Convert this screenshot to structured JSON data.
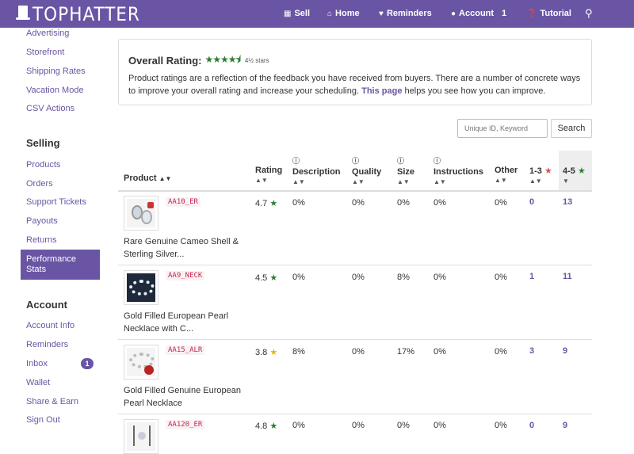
{
  "brand": "TOPHATTER",
  "nav": {
    "sell": "Sell",
    "home": "Home",
    "reminders": "Reminders",
    "account": "Account",
    "account_count": "1",
    "tutorial": "Tutorial"
  },
  "sidebar": {
    "top_items": [
      "Advertising",
      "Storefront",
      "Shipping Rates",
      "Vacation Mode",
      "CSV Actions"
    ],
    "selling_head": "Selling",
    "selling_items": [
      "Products",
      "Orders",
      "Support Tickets",
      "Payouts",
      "Returns"
    ],
    "active_item": "Performance Stats",
    "account_head": "Account",
    "account_items": [
      "Account Info",
      "Reminders",
      "Inbox",
      "Wallet",
      "Share & Earn",
      "Sign Out"
    ],
    "inbox_badge": "1"
  },
  "rating_panel": {
    "title": "Overall Rating:",
    "stars_label": "4½ stars",
    "text_before": "Product ratings are a reflection of the feedback you have received from buyers. There are a number of concrete ways to improve your overall rating and increase your scheduling. ",
    "link": "This page",
    "text_after": " helps you see how you can improve."
  },
  "search": {
    "placeholder": "Unique ID, Keyword",
    "button": "Search"
  },
  "table": {
    "headers": {
      "product": "Product",
      "rating": "Rating",
      "description": "Description",
      "quality": "Quality",
      "size": "Size",
      "instructions": "Instructions",
      "other": "Other",
      "low": "1-3",
      "high": "4-5"
    },
    "rows": [
      {
        "sku": "AA10_ER",
        "name": "Rare Genuine Cameo Shell & Sterling Silver...",
        "rating": "4.7",
        "description": "0%",
        "quality": "0%",
        "size": "0%",
        "instructions": "0%",
        "other": "0%",
        "low": "0",
        "high": "13"
      },
      {
        "sku": "AA9_NECK",
        "name": "Gold Filled European Pearl Necklace with C...",
        "rating": "4.5",
        "description": "0%",
        "quality": "0%",
        "size": "8%",
        "instructions": "0%",
        "other": "0%",
        "low": "1",
        "high": "11"
      },
      {
        "sku": "AA15_ALR",
        "name": "Gold Filled Genuine European Pearl Necklace",
        "rating": "3.8",
        "description": "8%",
        "quality": "0%",
        "size": "17%",
        "instructions": "0%",
        "other": "0%",
        "low": "3",
        "high": "9"
      },
      {
        "sku": "AA120_ER",
        "name": "",
        "rating": "4.8",
        "description": "0%",
        "quality": "0%",
        "size": "0%",
        "instructions": "0%",
        "other": "0%",
        "low": "0",
        "high": "9"
      }
    ]
  },
  "colors": {
    "brand_purple": "#6a55a4",
    "star_green": "#2e7d32",
    "star_yellow": "#f0b400",
    "star_red": "#d9534f"
  }
}
